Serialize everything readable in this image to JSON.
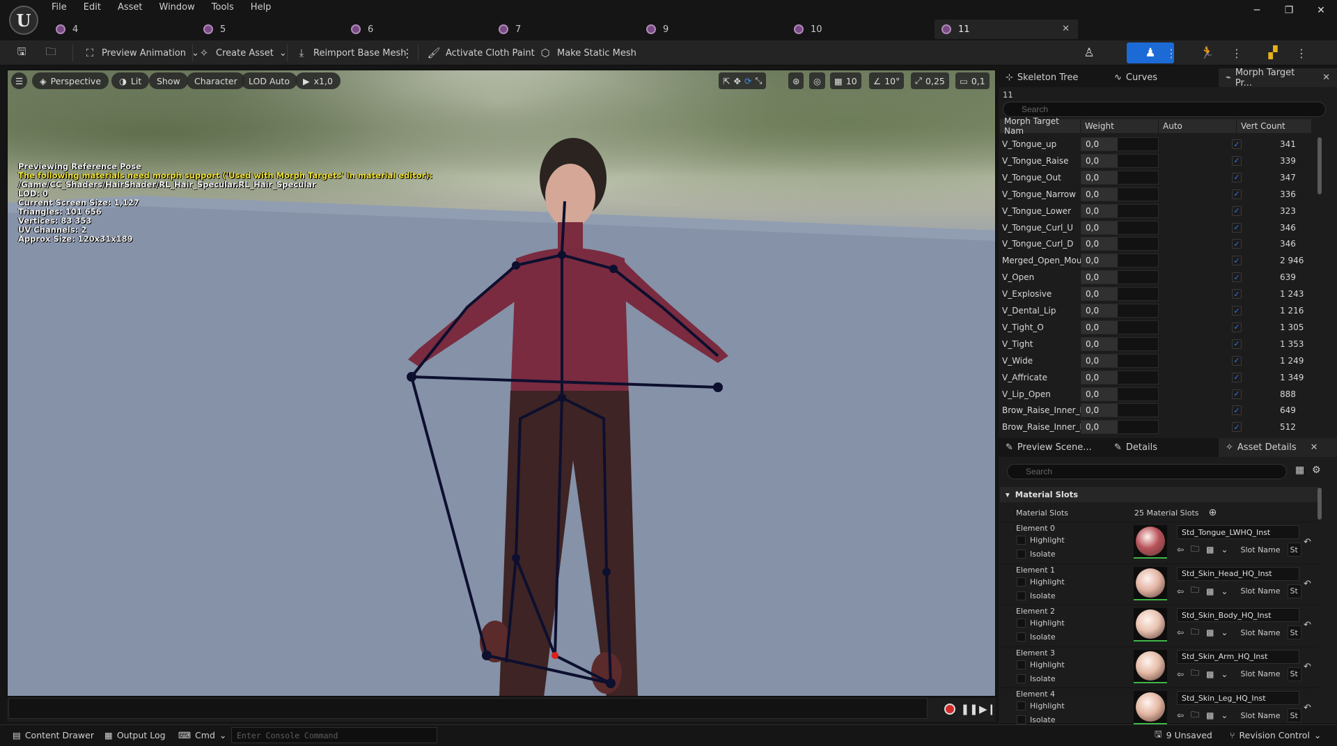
{
  "menu": [
    "File",
    "Edit",
    "Asset",
    "Window",
    "Tools",
    "Help"
  ],
  "doc_tabs": [
    "4",
    "5",
    "6",
    "7",
    "9",
    "10",
    "11"
  ],
  "toolbar": {
    "preview_animation": "Preview Animation",
    "create_asset": "Create Asset",
    "reimport": "Reimport Base Mesh",
    "cloth_paint": "Activate Cloth Paint",
    "static_mesh": "Make Static Mesh"
  },
  "viewport": {
    "perspective": "Perspective",
    "lit": "Lit",
    "show": "Show",
    "character": "Character",
    "lod": "LOD Auto",
    "speed": "x1,0",
    "grid_size": "10",
    "rot_snap": "10°",
    "scale_snap": "0,25",
    "cam_speed": "0,1",
    "overlay": {
      "line1": "Previewing Reference Pose",
      "warning": "The following materials need morph support ('Used with Morph Targets' in material editor):",
      "path": "/Game/CC_Shaders/HairShader/RL_Hair_Specular.RL_Hair_Specular",
      "lod": "LOD: 0",
      "screen_size": "Current Screen Size: 1,127",
      "triangles": "Triangles: 101 656",
      "vertices": "Vertices: 83 353",
      "uv": "UV Channels: 2",
      "approx": "Approx Size: 120x31x189"
    }
  },
  "status": {
    "content_drawer": "Content Drawer",
    "output_log": "Output Log",
    "cmd": "Cmd",
    "console_placeholder": "Enter Console Command",
    "unsaved": "9 Unsaved",
    "revision": "Revision Control"
  },
  "top_panel": {
    "tabs": [
      "Skeleton Tree",
      "Curves",
      "Morph Target Pr..."
    ],
    "asset_label": "11",
    "search_placeholder": "Search",
    "columns": [
      "Morph Target Nam",
      "Weight",
      "Auto",
      "Vert Count"
    ],
    "rows": [
      {
        "name": "V_Tongue_up",
        "weight": "0,0",
        "vc": "341"
      },
      {
        "name": "V_Tongue_Raise",
        "weight": "0,0",
        "vc": "339"
      },
      {
        "name": "V_Tongue_Out",
        "weight": "0,0",
        "vc": "347"
      },
      {
        "name": "V_Tongue_Narrow",
        "weight": "0,0",
        "vc": "336"
      },
      {
        "name": "V_Tongue_Lower",
        "weight": "0,0",
        "vc": "323"
      },
      {
        "name": "V_Tongue_Curl_U",
        "weight": "0,0",
        "vc": "346"
      },
      {
        "name": "V_Tongue_Curl_D",
        "weight": "0,0",
        "vc": "346"
      },
      {
        "name": "Merged_Open_Mout",
        "weight": "0,0",
        "vc": "2 946"
      },
      {
        "name": "V_Open",
        "weight": "0,0",
        "vc": "639"
      },
      {
        "name": "V_Explosive",
        "weight": "0,0",
        "vc": "1 243"
      },
      {
        "name": "V_Dental_Lip",
        "weight": "0,0",
        "vc": "1 216"
      },
      {
        "name": "V_Tight_O",
        "weight": "0,0",
        "vc": "1 305"
      },
      {
        "name": "V_Tight",
        "weight": "0,0",
        "vc": "1 353"
      },
      {
        "name": "V_Wide",
        "weight": "0,0",
        "vc": "1 249"
      },
      {
        "name": "V_Affricate",
        "weight": "0,0",
        "vc": "1 349"
      },
      {
        "name": "V_Lip_Open",
        "weight": "0,0",
        "vc": "888"
      },
      {
        "name": "Brow_Raise_Inner_L",
        "weight": "0,0",
        "vc": "649"
      },
      {
        "name": "Brow_Raise_Inner_R",
        "weight": "0,0",
        "vc": "512"
      }
    ]
  },
  "bottom_panel": {
    "tabs": [
      "Preview Scene...",
      "Details",
      "Asset Details"
    ],
    "search_placeholder": "Search",
    "section": "Material Slots",
    "slots_label": "Material Slots",
    "slots_count": "25 Material Slots",
    "highlight": "Highlight",
    "isolate": "Isolate",
    "slot_name": "Slot Name",
    "slot_val": "St",
    "elements": [
      {
        "label": "Element 0",
        "material": "Std_Tongue_LWHQ_Inst",
        "color": "#b8525a"
      },
      {
        "label": "Element 1",
        "material": "Std_Skin_Head_HQ_Inst",
        "color": "#e2b4a4"
      },
      {
        "label": "Element 2",
        "material": "Std_Skin_Body_HQ_Inst",
        "color": "#e8c2b0"
      },
      {
        "label": "Element 3",
        "material": "Std_Skin_Arm_HQ_Inst",
        "color": "#e6bca8"
      },
      {
        "label": "Element 4",
        "material": "Std_Skin_Leg_HQ_Inst",
        "color": "#e4b8a4"
      }
    ]
  }
}
